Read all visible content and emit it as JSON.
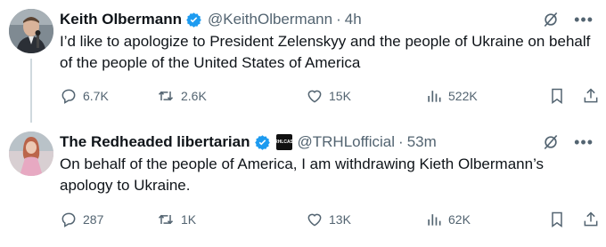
{
  "tweets": [
    {
      "name": "Keith Olbermann",
      "handle": "@KeithOlbermann",
      "time": "4h",
      "text": "I’d like to apologize to President Zelenskyy and the people of Ukraine on behalf of the people of the United States of America",
      "replies": "6.7K",
      "reposts": "2.6K",
      "likes": "15K",
      "views": "522K"
    },
    {
      "name": "The Redheaded libertarian",
      "handle": "@TRHLofficial",
      "affiliate_badge": "TRHLCAST",
      "time": "53m",
      "text": "On behalf of the people of America, I am withdrawing Kieth Olbermann’s apology to Ukraine.",
      "replies": "287",
      "reposts": "1K",
      "likes": "13K",
      "views": "62K"
    }
  ],
  "separator": "·",
  "icons": {
    "verified": "verified-badge-icon",
    "grok": "grok-icon",
    "more": "more-icon",
    "reply": "reply-icon",
    "repost": "repost-icon",
    "like": "heart-icon",
    "views": "views-icon",
    "bookmark": "bookmark-icon",
    "share": "share-icon"
  },
  "colors": {
    "verified": "#1d9bf0",
    "secondary_text": "#536471",
    "text": "#0f1419",
    "thread_line": "#cfd9de"
  }
}
